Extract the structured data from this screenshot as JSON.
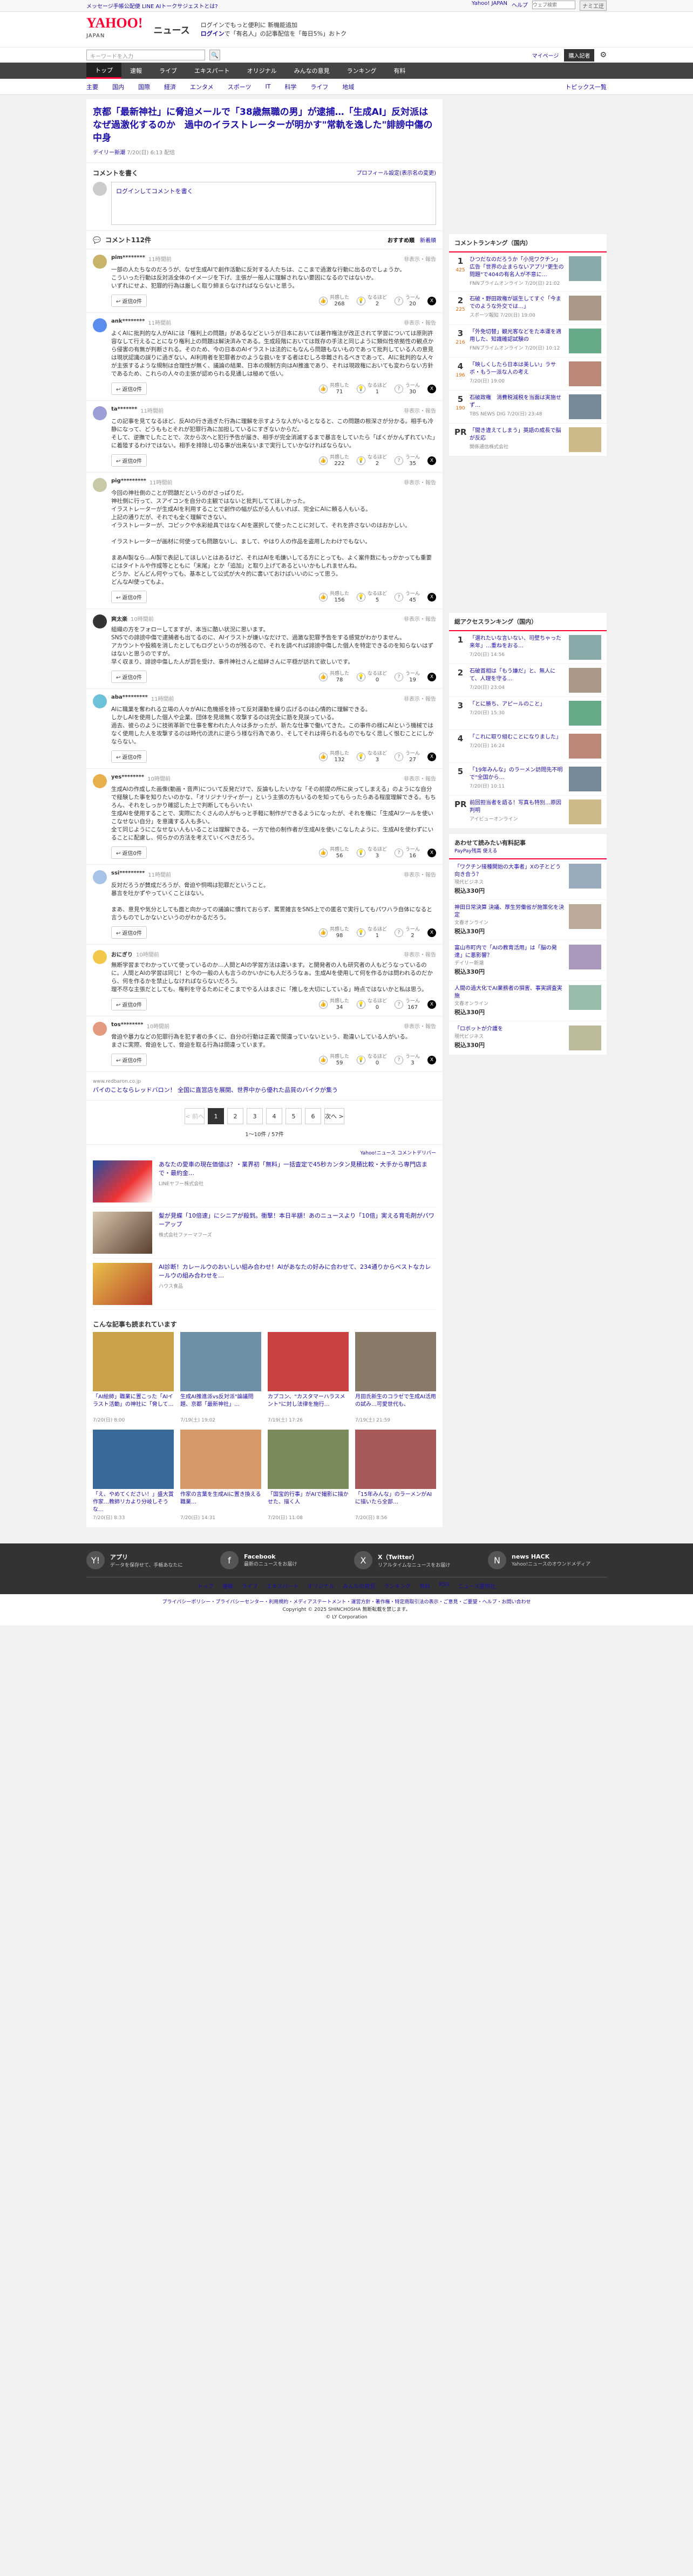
{
  "topbar": {
    "promo": "メッセージ手帳公配便 LINE AIトークサジェストとは?",
    "links": [
      "Yahoo! JAPAN",
      "ヘルプ"
    ],
    "search_placeholder": "ウェブ検索",
    "search_btn": "ナミ工迂"
  },
  "header": {
    "logo": "YAHOO!",
    "logo_sub": "JAPAN",
    "news": "ニュース",
    "promo_line1": "ログインでもっと便利に 新機能追加",
    "promo_login": "ログイン",
    "promo_line2": "で「有名人」の記事配信を「毎日5%」おトク"
  },
  "search": {
    "placeholder": "キーワードを入力",
    "mypage": "マイページ",
    "register": "購入記者"
  },
  "gnav": [
    "トップ",
    "速報",
    "ライブ",
    "エキスパート",
    "オリジナル",
    "みんなの意見",
    "ランキング",
    "有料"
  ],
  "snav": [
    "主要",
    "国内",
    "国際",
    "経済",
    "エンタメ",
    "スポーツ",
    "IT",
    "科学",
    "ライフ",
    "地域"
  ],
  "snav_right": "トピックス一覧",
  "article": {
    "title": "京都「最新神社」に脅迫メールで「38歳無職の男」が逮捕…「生成AI」反対派はなぜ過激化するのか　過中のイラストレーターが明かす\"常軌を逸した\"誹謗中傷の中身",
    "source": "デイリー新潮",
    "date": "7/20(日) 6:13 配信"
  },
  "comment_form": {
    "heading": "コメントを書く",
    "link": "プロフィール設定(表示名の変更)",
    "placeholder": "ログインしてコメントを書く"
  },
  "comments_header": {
    "title": "コメント112件",
    "sort_recommend": "おすすめ順",
    "sort_new": "新着順"
  },
  "comments": [
    {
      "user": "pim********",
      "time": "11時間前",
      "report": "非表示・報告",
      "text": "一部の人たちなのだろうが、なぜ生成AIで創作活動に反対する人たちは、ここまで過激な行動に出るのでしょうか。\nこういった行動は反対派全体のイメージを下げ、主張が一般人に理解されない要因になるのではないか。\nいずれにせよ、犯罪的行為は厳しく取り締まらなければならないと思う。",
      "likes": "268",
      "nah": "2",
      "hmm": "20",
      "color": "#c7b36a"
    },
    {
      "user": "ank********",
      "time": "11時間前",
      "report": "非表示・報告",
      "text": "よくAIに批判的な人がAIには「権利上の問題」があるなどというが日本においては著作権法が改正されて学習については原則許容なして行えることになり権利上の問題は解決済みである。生成段階においては既存の手法と同じように類似性依拠性の観点から侵害の有無が判断される。そのため、今の日本のAIイラストは法的にもなんら問題もないものであって批判している人の意見は現状認識の誤りに過ぎない。AI利用者を犯罪者かのような扱いをする者はむしろ非難されるべきであって、AIに批判的な人々が主張するような規制は合理性が無く、議論の結果、日本の規制方向はAI推進であり、それは現政権においても変わらない方針であるため、これらの人々の主張が認められる見通しは極めて低い。",
      "likes": "71",
      "nah": "1",
      "hmm": "30",
      "color": "#5b8def"
    },
    {
      "user": "ta*******",
      "time": "11時間前",
      "report": "非表示・報告",
      "text": "この記事を見てなるほど、反AIの行き過ぎた行為に理解を示すような人がいるとなると、この問題の根深さが分かる。相手も冷静になって、どうももとそれが犯罪行為に加担しているにすぎないからだ。\nそして、逆撫でしたことで、次から次へと犯行予告が届き、相手が完全消滅するまで暴言をしていたら「ばくがかんずれていた」に着陸するわけではない。相手を排除し切る事が出来ないまで実行していかなければならない。",
      "likes": "222",
      "nah": "2",
      "hmm": "35",
      "color": "#9aa0d6"
    },
    {
      "user": "pig*********",
      "time": "11時間前",
      "report": "非表示・報告",
      "text": "今回の神社側のことが問題だというのがさっぱりだ。\n神社側に行って、スアイコンを自分の主観ではないと批判しててほしかった。\nイラストレーターが生成AIを利用することで創作の幅が広がる人もいれば、完全にAIに頼る人もいる。\n上記の通りだが、それでも全く理解できない。\nイラストレーターが、コピックや水彩絵具ではなくAIを選択して使ったことに対して、それを許さないのはおかしい。\n\nイラストレーターが画材に何使っても問題ないし、まして、やはり人の作品を盗用したわけでもない。\n\nまあAI製なら…AI製で表記してほしいとはあるけど、それはAIを毛嫌いしてる方にとっても、よく案件数にもっかかっても重要にはタイトルや作成等とともに「末尾」とか「追加」と取り上げてあるといいかもしれませんね。\nどうか、どんどん何やっても、基本として公式が大々的に書いておけばいいのにって思う。\nどんなAI使ってもよ。",
      "likes": "156",
      "nah": "5",
      "hmm": "45",
      "color": "#c9c9a8"
    },
    {
      "user": "爽太楽",
      "time": "10時間前",
      "report": "非表示・報告",
      "text": "組織の方をフォローしてますが、本当に酷い状況に思います。\nSNSでの誹謗中傷で逮捕者も出てるのに、AIイラストが嫌いなだけで、過激な犯罪予告をする感覚がわかりません。\nアカウントや投稿を消したとしてもログというのが残るので、それを調べれば誹謗中傷した個人を特定できるのを知らないはずはないと思うのですが。\n早く収まり、誹謗中傷した人が罰を受け、事件神社さんと組絆さんに平穏が訪れて欲しいです。",
      "likes": "78",
      "nah": "0",
      "hmm": "19",
      "color": "#333"
    },
    {
      "user": "aba*********",
      "time": "11時間前",
      "report": "非表示・報告",
      "text": "AIに職業を奪われる立場の人々がAIに危機感を持って反対運動を繰り広げるのは心情的に理解できる。\nしかしAIを使用した個人や企業、団体を見境無く攻撃するのは完全に筋を見誤っている。\n過去、彼らのように技術革新で仕事を奪われた人々は多かったが、新たな仕事で働いてきた。この事件の様にAIという機械ではなく使用した人を攻撃するのは時代の流れに逆らう様な行為であり、そしてそれは得られるものでもなく悲しく恨むことにしかならない。",
      "likes": "132",
      "nah": "3",
      "hmm": "27",
      "color": "#6cc2d9"
    },
    {
      "user": "yes********",
      "time": "10時間前",
      "report": "非表示・報告",
      "text": "生成AIの作成した画像(動画・音声)について反発だけで、反論もしたいかな「その前提の所に戻ってしまえる」のようにな自分で経験した事を知りたいのかな、「オリジナリティがー」という主張の方もいるのを知ってもらったらある程度理解できる。もちろん、それをしっかり確認した上で判断してもらいたい\n生成AIを使用することで、実際にたくさんの人がもっと手軽に制作ができるようになったが、それを機に「生成AIツールを使いこなせない自分」を意識する人も多い。\n全て同じようにこなせない人もいることは理解できる。一方で他の制作者が生成AIを使いこなしたように、生成AIを使わずにいることに配慮し、何らかの方法を考えていくべきだろう。",
      "likes": "56",
      "nah": "3",
      "hmm": "16",
      "color": "#e8b04b"
    },
    {
      "user": "ssi*********",
      "time": "11時間前",
      "report": "非表示・報告",
      "text": "反対だろうが賛成だろうが、脅迫や恫喝は犯罪だということ。\n暴言を吐かずやっていくことはない。\n\nまあ、意見や気分としても面と向かっての議論に慣れておらず、罵詈雑言をSNS上での匿名で実行してもパワハラ自体になると言うものでしかないというのがわかるだろう。",
      "likes": "98",
      "nah": "1",
      "hmm": "2",
      "color": "#a7c4e8"
    },
    {
      "user": "おにぎり",
      "time": "10時間前",
      "report": "非表示・報告",
      "text": "無断学習までわかっていて使っているのか…人間とAIの学習方法は違います。と開発者の人も研究者の人もどうなっているのに。人間とAIの学習は同じ！と今の一般の人も言うのかいかにも人だろうなぁ。生成AIを使用して何を作るかは問われるのだから、何を作るかを禁止しなければならないだろう。\n理不尽な主張だとしても、権利を守るためにそこまでやる人はまさに「推しを大切にしている」時点ではないかと私は思う。",
      "likes": "34",
      "nah": "0",
      "hmm": "167",
      "color": "#f2c84b"
    },
    {
      "user": "tos********",
      "time": "10時間前",
      "report": "非表示・報告",
      "text": "脅迫や暴力などの犯罪行為を犯す者の多くに、自分の行動は正義で間違っていないという、勘違いしている人がいる。\nまさに実際、脅迫をして、脅迫を取る行為は間違っています。",
      "likes": "59",
      "nah": "0",
      "hmm": "3",
      "color": "#e39a7f"
    }
  ],
  "inline_ad": {
    "url": "www.redbaron.co.jp",
    "text": "パイのことならレッドバロン！ 全国に直営店を展開、世界中から優れた品質のバイクが集う"
  },
  "pager": {
    "prev": "< 前へ",
    "pages": [
      "1",
      "2",
      "3",
      "4",
      "5",
      "6"
    ],
    "next": "次へ >",
    "count": "1〜10件 / 57件"
  },
  "ad_label": "Yahoo!ニュース コメントデリバー",
  "ads": [
    {
      "title": "あなたの愛車の現在価値は？・業界初「無料」一括査定で45秒カンタン見積比較・大手から専門店まで・最約金…",
      "sponsor": "LINEヤフー株式会社"
    },
    {
      "title": "髪が見蝶「10倍速」にシニアが殺到。衝撃！本日半額！あのニュースより「10倍」実える育毛剤がパワーアップ",
      "sponsor": "株式会社ファーマフーズ"
    },
    {
      "title": "AI診断！カレールウのおいしい組み合わせ！AIがあなたの好みに合わせて、234通りからベストなカレールウの組み合わせを…",
      "sponsor": "ハウス食品"
    }
  ],
  "recommend_heading": "こんな記事も読まれています",
  "recommend": [
    {
      "title": "「AI絵師」職業に置こった「AIイラスト活動」の神社に「脅して…",
      "meta": "7/20(日) 8:00"
    },
    {
      "title": "生成AI推進派vs反対派\"論議問題、京都「最新神社」…",
      "meta": "7/19(土) 19:02"
    },
    {
      "title": "カプコン、\"カスタマーハラスメント\"に対し法律を施行…",
      "meta": "7/19(土) 17:26"
    },
    {
      "title": "月田氏新生のコラゼで生成AI活用の試み…可愛世代も、",
      "meta": "7/19(土) 21:59"
    },
    {
      "title": "「え、やめてください！」盛大賞作家…教師リカより分岐しそうな…",
      "meta": "7/20(日) 8:33"
    },
    {
      "title": "作家の言葉を生成AIに置き換える職業…",
      "meta": "7/20(日) 14:31"
    },
    {
      "title": "「国宝的行事」がAIで撮影に描かせた、描く人",
      "meta": "7/20(日) 11:08"
    },
    {
      "title": "「15年みんな」のラーメンがAIに描いたら全部…",
      "meta": "7/20(日) 8:56"
    }
  ],
  "ranking_heading": "コメントランキング（国内）",
  "ranking": [
    {
      "no": "1",
      "count": "425",
      "title": "ひつだなのだろうか「小児ワクチン」広告「世界の止まらないアプリ\"更生の問題\"で404の有名人が不意に…",
      "meta": "FNNプライムオンライン 7/20(日) 21:02"
    },
    {
      "no": "2",
      "count": "225",
      "title": "石破・野田政権が誕生してすぐ「今までのような外交では…」",
      "meta": "スポーツ報知 7/20(日) 19:00"
    },
    {
      "no": "3",
      "count": "216",
      "title": "「外免切替」観光客などをた本運を適用した、知識確認試験の",
      "meta": "FNNプライムオンライン 7/20(日) 10:12"
    },
    {
      "no": "4",
      "count": "196",
      "title": "「映しくしたら日本は美しい」ラサボ・もう一派な人の考え",
      "meta": "7/20(日) 19:00"
    },
    {
      "no": "5",
      "count": "190",
      "title": "石破政権　消費税減税を当面は実施せず…",
      "meta": "TBS NEWS DIG 7/20(日) 23:48"
    },
    {
      "no": "PR",
      "count": "",
      "title": "「間き違えてしまう」英語の成長で脳が反応",
      "meta": "関係通信株式会社"
    }
  ],
  "access_heading": "総アクセスランキング（国内）",
  "access": [
    {
      "no": "1",
      "title": "「選れたいな言いない、司壁ちゃった来年」…重ねをおる…",
      "meta": "7/20(日) 14:56"
    },
    {
      "no": "2",
      "title": "石破首相は「もう嫌だ」と、無人にて、人理を守る…",
      "meta": "7/20(日) 23:04"
    },
    {
      "no": "3",
      "title": "「とに勝ち、アピールのこと」",
      "meta": "7/20(日) 15:30"
    },
    {
      "no": "4",
      "title": "「これに取り組むことになりました」",
      "meta": "7/20(日) 16:24"
    },
    {
      "no": "5",
      "title": "「19年みんな」のラーメン訪問先不明で\"全国から…",
      "meta": "7/20(日) 10:11"
    },
    {
      "no": "PR",
      "title": "前回担当者を語る！写真も特別…原因判明",
      "meta": "アイビューオンライン"
    }
  ],
  "paid_heading": "あわせて読みたい有料記事",
  "paid_sub": "PayPay残高 使える",
  "paid": [
    {
      "title": "「ワクチン接種開始の大事者」Xの子とどう向き合う？",
      "meta": "現代ビジネス",
      "price": "税込330円"
    },
    {
      "title": "神田日常決算 決議、厚生労働省が施策化を決定",
      "meta": "文春オンライン",
      "price": "税込330円"
    },
    {
      "title": "富山市町内で「AIの教育活用」は「脳の発達」に悪影響？",
      "meta": "デイリー新潮",
      "price": "税込330円"
    },
    {
      "title": "人間の過大化でAI業務者の損害、事実調査実施",
      "meta": "文春オンライン",
      "price": "税込330円"
    },
    {
      "title": "「ロボットが介護を",
      "meta": "現代ビジネス",
      "price": "税込330円"
    }
  ],
  "footer": {
    "apps": [
      {
        "name": "アプリ",
        "desc": "データを保存せて、手帳あなたに",
        "icon": "Y!"
      },
      {
        "name": "Facebook",
        "desc": "最新のニュースをお届け",
        "icon": "f"
      },
      {
        "name": "X（Twitter）",
        "desc": "リアルタイムなニュースをお届け",
        "icon": "X"
      },
      {
        "name": "news HACK",
        "desc": "Yahoo!ニュースのオウンドメディア",
        "icon": "N"
      }
    ],
    "nav": [
      "トップ",
      "速報",
      "ライブ",
      "エキスパート",
      "オリジナル",
      "みんなの意見",
      "ランキング",
      "有料",
      "RSS",
      "ニュース提供社"
    ],
    "links": "プライバシーポリシー・プライバシーセンター・利用規約・メディアステートメント・運営方針・著作権・特定商取引法の表示・ご意見・ご要望・ヘルプ・お問い合わせ",
    "copyright": "Copyright © 2025 SHINCHOSHA 無断転載を禁じます。",
    "copyright2": "© LY Corporation"
  }
}
